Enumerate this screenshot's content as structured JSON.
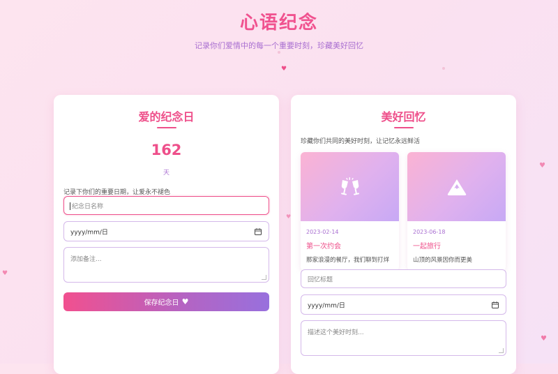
{
  "header": {
    "title": "心语纪念",
    "subtitle": "记录你们爱情中的每一个重要时刻，珍藏美好回忆"
  },
  "anniversary": {
    "title": "爱的纪念日",
    "days_count": "162",
    "days_unit": "天",
    "description": "记录下你们的重要日期，让爱永不褪色",
    "name_placeholder": "纪念日名称",
    "date_placeholder": "yyyy/mm/日",
    "note_placeholder": "添加备注...",
    "save_label": "保存纪念日"
  },
  "memories": {
    "title": "美好回忆",
    "description": "珍藏你们共同的美好时刻，让记忆永远鲜活",
    "items": [
      {
        "date": "2023-02-14",
        "title": "第一次约会",
        "text": "那家浪漫的餐厅，我们聊到打烊",
        "icon": "toast-glasses-icon"
      },
      {
        "date": "2023-06-18",
        "title": "一起旅行",
        "text": "山顶的风景因你而更美",
        "icon": "mountain-icon"
      }
    ],
    "title_placeholder": "回忆标题",
    "date_placeholder": "yyyy/mm/日",
    "desc_placeholder": "描述这个美好时刻..."
  },
  "colors": {
    "accent": "#ee4f8a",
    "secondary": "#a96fd1",
    "button_gradient_start": "#f1508f",
    "button_gradient_end": "#9870dd"
  }
}
